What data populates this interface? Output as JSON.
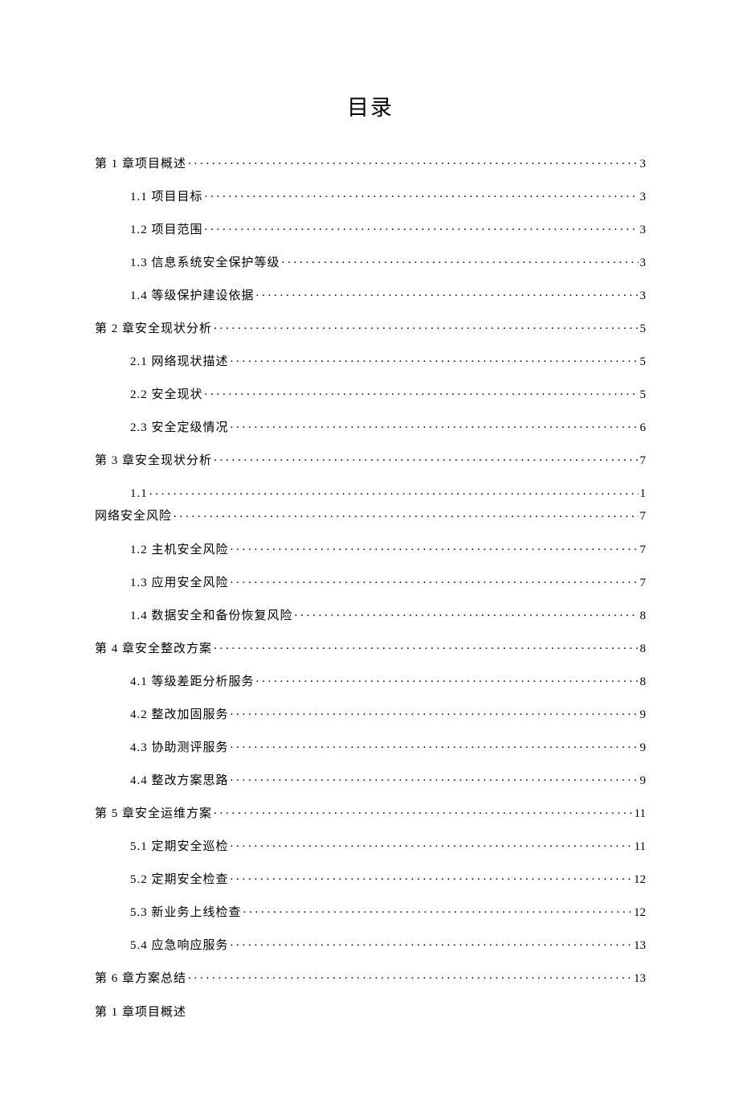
{
  "title": "目录",
  "entries": [
    {
      "level": 1,
      "label": "第 1 章项目概述",
      "page": "3"
    },
    {
      "level": 2,
      "label": "1.1  项目目标",
      "page": "3"
    },
    {
      "level": 2,
      "label": "1.2  项目范围",
      "page": "3"
    },
    {
      "level": 2,
      "label": "1.3  信息系统安全保护等级",
      "page": "3"
    },
    {
      "level": 2,
      "label": "1.4  等级保护建设依据",
      "page": "3"
    },
    {
      "level": 1,
      "label": "第 2 章安全现状分析",
      "page": "5"
    },
    {
      "level": 2,
      "label": "2.1  网络现状描述",
      "page": "5"
    },
    {
      "level": 2,
      "label": "2.2  安全现状",
      "page": "5"
    },
    {
      "level": 2,
      "label": "2.3  安全定级情况",
      "page": "6"
    },
    {
      "level": 1,
      "label": "第 3 章安全现状分析",
      "page": "7"
    },
    {
      "level": 0,
      "wrap": true,
      "label_top": "1.1",
      "page_top": "1",
      "label_bottom": "网络安全风险",
      "page_bottom": "7"
    },
    {
      "level": 2,
      "label": "1.2  主机安全风险",
      "page": "7"
    },
    {
      "level": 2,
      "label": "1.3  应用安全风险",
      "page": "7"
    },
    {
      "level": 2,
      "label": "1.4  数据安全和备份恢复风险",
      "page": "8"
    },
    {
      "level": 1,
      "label": "第 4 章安全整改方案",
      "page": "8"
    },
    {
      "level": 2,
      "label": "4.1  等级差距分析服务",
      "page": "8"
    },
    {
      "level": 2,
      "label": "4.2  整改加固服务",
      "page": "9"
    },
    {
      "level": 2,
      "label": "4.3  协助测评服务",
      "page": "9"
    },
    {
      "level": 2,
      "label": "4.4  整改方案思路",
      "page": "9"
    },
    {
      "level": 1,
      "label": "第 5 章安全运维方案",
      "page": "11"
    },
    {
      "level": 2,
      "label": "5.1 定期安全巡检",
      "page": "11"
    },
    {
      "level": 2,
      "label": "5.2  定期安全检查",
      "page": "12"
    },
    {
      "level": 2,
      "label": "5.3  新业务上线检查",
      "page": "12"
    },
    {
      "level": 2,
      "label": "5.4  应急响应服务",
      "page": "13"
    },
    {
      "level": 1,
      "label": "第 6 章方案总结",
      "page": "13"
    }
  ],
  "footer_line": "第 1 章项目概述"
}
